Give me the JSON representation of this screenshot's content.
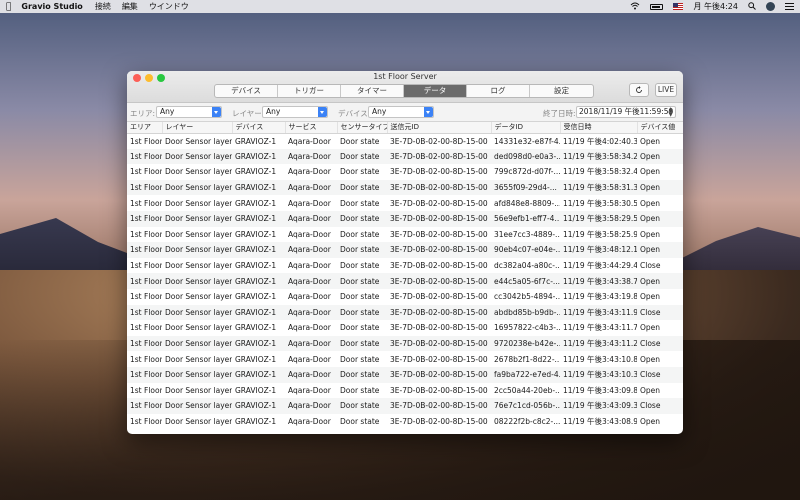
{
  "menubar": {
    "app_name": "Gravio Studio",
    "menus": [
      "接続",
      "編集",
      "ウインドウ"
    ],
    "datetime": "月 午後4:24"
  },
  "window": {
    "title": "1st Floor Server",
    "tabs": [
      {
        "label": "デバイス",
        "active": false
      },
      {
        "label": "トリガー",
        "active": false
      },
      {
        "label": "タイマー",
        "active": false
      },
      {
        "label": "データ",
        "active": true
      },
      {
        "label": "ログ",
        "active": false
      },
      {
        "label": "設定",
        "active": false
      }
    ],
    "live_label": "LIVE"
  },
  "filters": {
    "area_label": "エリア:",
    "area_value": "Any",
    "layer_label": "レイヤー:",
    "layer_value": "Any",
    "device_label": "デバイス:",
    "device_value": "Any",
    "end_date_label": "終了日時:",
    "end_date_value": "2018/11/19 午後11:59:59"
  },
  "table": {
    "columns": [
      "エリア",
      "レイヤー",
      "デバイス",
      "サービス",
      "センサータイプ",
      "送信元ID",
      "データID",
      "受信日時",
      "デバイス値"
    ],
    "rows": [
      [
        "1st Floor",
        "Door Sensor layer",
        "GRAVIOZ-1",
        "Aqara-Door",
        "Door state",
        "3E-7D-0B-02-00-8D-15-00",
        "14331e32-e87f-4...",
        "11/19 午後4:02:40.37",
        "Open"
      ],
      [
        "1st Floor",
        "Door Sensor layer",
        "GRAVIOZ-1",
        "Aqara-Door",
        "Door state",
        "3E-7D-0B-02-00-8D-15-00",
        "ded098d0-e0a3-...",
        "11/19 午後3:58:34.26",
        "Open"
      ],
      [
        "1st Floor",
        "Door Sensor layer",
        "GRAVIOZ-1",
        "Aqara-Door",
        "Door state",
        "3E-7D-0B-02-00-8D-15-00",
        "799c872d-d07f-...",
        "11/19 午後3:58:32.47",
        "Open"
      ],
      [
        "1st Floor",
        "Door Sensor layer",
        "GRAVIOZ-1",
        "Aqara-Door",
        "Door state",
        "3E-7D-0B-02-00-8D-15-00",
        "3655f09-29d4-...",
        "11/19 午後3:58:31.39",
        "Open"
      ],
      [
        "1st Floor",
        "Door Sensor layer",
        "GRAVIOZ-1",
        "Aqara-Door",
        "Door state",
        "3E-7D-0B-02-00-8D-15-00",
        "afd848e8-8809-...",
        "11/19 午後3:58:30.55",
        "Open"
      ],
      [
        "1st Floor",
        "Door Sensor layer",
        "GRAVIOZ-1",
        "Aqara-Door",
        "Door state",
        "3E-7D-0B-02-00-8D-15-00",
        "56e9efb1-eff7-4...",
        "11/19 午後3:58:29.57",
        "Open"
      ],
      [
        "1st Floor",
        "Door Sensor layer",
        "GRAVIOZ-1",
        "Aqara-Door",
        "Door state",
        "3E-7D-0B-02-00-8D-15-00",
        "31ee7cc3-4889-...",
        "11/19 午後3:58:25.97",
        "Open"
      ],
      [
        "1st Floor",
        "Door Sensor layer",
        "GRAVIOZ-1",
        "Aqara-Door",
        "Door state",
        "3E-7D-0B-02-00-8D-15-00",
        "90eb4c07-e04e-...",
        "11/19 午後3:48:12.12",
        "Open"
      ],
      [
        "1st Floor",
        "Door Sensor layer",
        "GRAVIOZ-1",
        "Aqara-Door",
        "Door state",
        "3E-7D-0B-02-00-8D-15-00",
        "dc382a04-a80c-...",
        "11/19 午後3:44:29.40",
        "Close"
      ],
      [
        "1st Floor",
        "Door Sensor layer",
        "GRAVIOZ-1",
        "Aqara-Door",
        "Door state",
        "3E-7D-0B-02-00-8D-15-00",
        "e44c5a05-6f7c-...",
        "11/19 午後3:43:38.78",
        "Open"
      ],
      [
        "1st Floor",
        "Door Sensor layer",
        "GRAVIOZ-1",
        "Aqara-Door",
        "Door state",
        "3E-7D-0B-02-00-8D-15-00",
        "cc3042b5-4894-...",
        "11/19 午後3:43:19.81",
        "Open"
      ],
      [
        "1st Floor",
        "Door Sensor layer",
        "GRAVIOZ-1",
        "Aqara-Door",
        "Door state",
        "3E-7D-0B-02-00-8D-15-00",
        "abdbd85b-b9db-...",
        "11/19 午後3:43:11.96",
        "Close"
      ],
      [
        "1st Floor",
        "Door Sensor layer",
        "GRAVIOZ-1",
        "Aqara-Door",
        "Door state",
        "3E-7D-0B-02-00-8D-15-00",
        "16957822-c4b3-...",
        "11/19 午後3:43:11.72",
        "Open"
      ],
      [
        "1st Floor",
        "Door Sensor layer",
        "GRAVIOZ-1",
        "Aqara-Door",
        "Door state",
        "3E-7D-0B-02-00-8D-15-00",
        "9720238e-b42e-...",
        "11/19 午後3:43:11.23",
        "Close"
      ],
      [
        "1st Floor",
        "Door Sensor layer",
        "GRAVIOZ-1",
        "Aqara-Door",
        "Door state",
        "3E-7D-0B-02-00-8D-15-00",
        "2678b2f1-8d22-...",
        "11/19 午後3:43:10.85",
        "Open"
      ],
      [
        "1st Floor",
        "Door Sensor layer",
        "GRAVIOZ-1",
        "Aqara-Door",
        "Door state",
        "3E-7D-0B-02-00-8D-15-00",
        "fa9ba722-e7ed-4...",
        "11/19 午後3:43:10.37",
        "Close"
      ],
      [
        "1st Floor",
        "Door Sensor layer",
        "GRAVIOZ-1",
        "Aqara-Door",
        "Door state",
        "3E-7D-0B-02-00-8D-15-00",
        "2cc50a44-20eb-...",
        "11/19 午後3:43:09.87",
        "Open"
      ],
      [
        "1st Floor",
        "Door Sensor layer",
        "GRAVIOZ-1",
        "Aqara-Door",
        "Door state",
        "3E-7D-0B-02-00-8D-15-00",
        "76e7c1cd-056b-...",
        "11/19 午後3:43:09.30",
        "Close"
      ],
      [
        "1st Floor",
        "Door Sensor layer",
        "GRAVIOZ-1",
        "Aqara-Door",
        "Door state",
        "3E-7D-0B-02-00-8D-15-00",
        "08222f2b-c8c2-...",
        "11/19 午後3:43:08.94",
        "Open"
      ]
    ]
  }
}
